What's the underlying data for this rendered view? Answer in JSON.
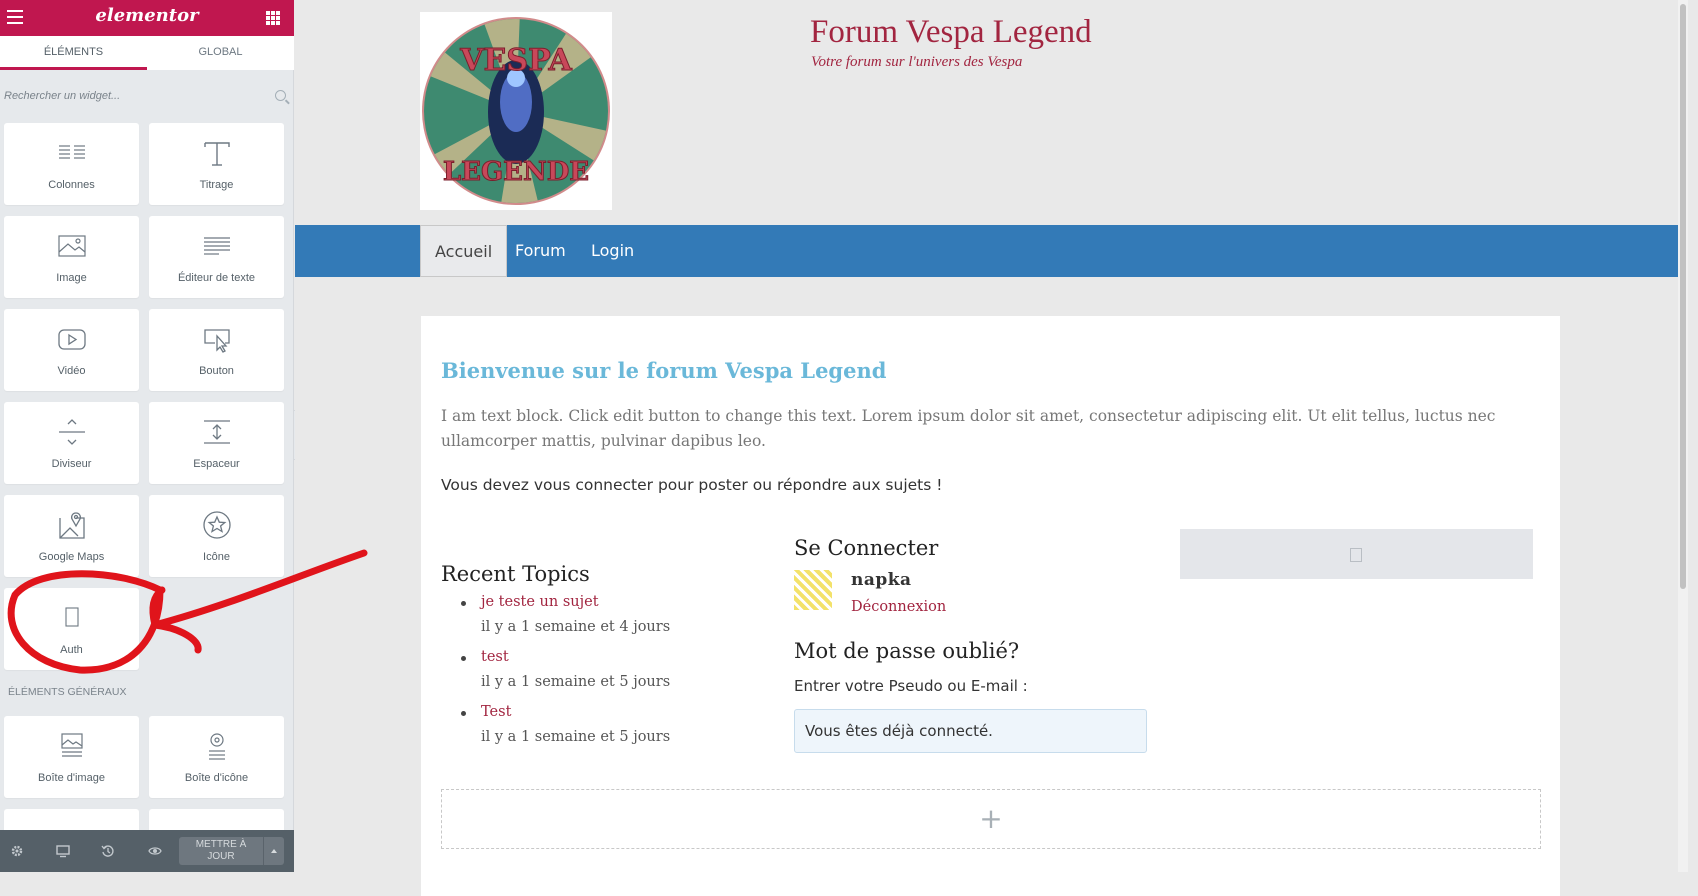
{
  "sidebar": {
    "brand": "elementor",
    "tabs": [
      {
        "label": "ÉLÉMENTS",
        "active": true
      },
      {
        "label": "GLOBAL",
        "active": false
      }
    ],
    "search_placeholder": "Rechercher un widget...",
    "widgets": [
      {
        "label": "Colonnes",
        "icon": "columns-icon"
      },
      {
        "label": "Titrage",
        "icon": "heading-icon"
      },
      {
        "label": "Image",
        "icon": "image-icon"
      },
      {
        "label": "Éditeur de texte",
        "icon": "text-editor-icon"
      },
      {
        "label": "Vidéo",
        "icon": "video-icon"
      },
      {
        "label": "Bouton",
        "icon": "button-icon"
      },
      {
        "label": "Diviseur",
        "icon": "divider-icon"
      },
      {
        "label": "Espaceur",
        "icon": "spacer-icon"
      },
      {
        "label": "Google Maps",
        "icon": "map-icon"
      },
      {
        "label": "Icône",
        "icon": "star-icon"
      },
      {
        "label": "Auth",
        "icon": "auth-icon"
      }
    ],
    "section_general": "ÉLÉMENTS GÉNÉRAUX",
    "general_widgets": [
      {
        "label": "Boîte d'image",
        "icon": "image-box-icon"
      },
      {
        "label": "Boîte d'icône",
        "icon": "icon-box-icon"
      }
    ],
    "update_button": "METTRE À\nJOUR"
  },
  "site": {
    "title": "Forum Vespa Legend",
    "tagline": "Votre forum sur l'univers des Vespa",
    "logo_text": [
      "VESPA",
      "LEGENDE"
    ],
    "nav": [
      {
        "label": "Accueil",
        "active": true
      },
      {
        "label": "Forum",
        "active": false
      },
      {
        "label": "Login",
        "active": false
      }
    ]
  },
  "content": {
    "welcome": "Bienvenue sur le forum Vespa Legend",
    "lorem": "I am text block. Click edit button to change this text. Lorem ipsum dolor sit amet, consectetur adipiscing elit. Ut elit tellus, luctus nec ullamcorper mattis, pulvinar dapibus leo.",
    "notice": "Vous devez vous connecter pour poster ou répondre aux sujets !",
    "recent_title": "Recent Topics",
    "topics": [
      {
        "title": "je teste un sujet",
        "date": "il y a 1 semaine et 4 jours"
      },
      {
        "title": "test",
        "date": "il y a 1 semaine et 5 jours"
      },
      {
        "title": "Test",
        "date": "il y a 1 semaine et 5 jours"
      }
    ],
    "login_title": "Se Connecter",
    "username": "napka",
    "logout": "Déconnexion",
    "pw_title": "Mot de passe oublié?",
    "pw_label": "Entrer votre Pseudo ou E-mail :",
    "pw_message": "Vous êtes déjà connecté.",
    "add_symbol": "+"
  },
  "colors": {
    "brand": "#c0174f",
    "nav": "#337ab7",
    "title": "#a22540",
    "welcome": "#6ab8d9",
    "annotation": "#e0141b"
  }
}
